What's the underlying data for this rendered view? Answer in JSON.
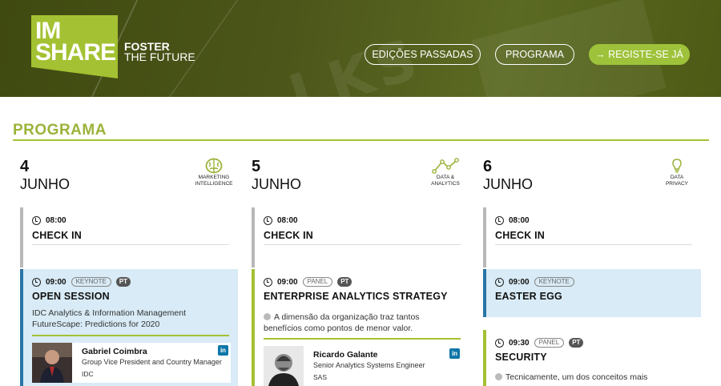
{
  "header": {
    "logo_line1": "IM",
    "logo_line2": "SHARE",
    "tagline1": "FOSTER",
    "tagline2": "THE FUTURE",
    "nav": {
      "past_editions": "EDIÇÕES PASSADAS",
      "program": "PROGRAMA",
      "register": "→ REGISTE-SE JÁ"
    },
    "ghost_text": "LKS"
  },
  "section_title": "PROGRAMA",
  "days": [
    {
      "num": "4",
      "month": "JUNHO",
      "track_line1": "MARKETING",
      "track_line2": "INTELLIGENCE",
      "track_icon": "brain-icon",
      "checkin": {
        "time": "08:00",
        "title": "CHECK IN"
      },
      "session": {
        "time": "09:00",
        "tag": "KEYNOTE",
        "lang": "PT",
        "title": "OPEN SESSION",
        "desc_line1": "IDC Analytics & Information Management",
        "desc_line2": "FutureScape: Predictions for 2020",
        "speaker": {
          "name": "Gabriel Coimbra",
          "role": "Group Vice President and Country Manager",
          "org": "IDC"
        }
      }
    },
    {
      "num": "5",
      "month": "JUNHO",
      "track_line1": "DATA &",
      "track_line2": "ANALYTICS",
      "track_icon": "chart-line-icon",
      "checkin": {
        "time": "08:00",
        "title": "CHECK IN"
      },
      "session": {
        "time": "09:00",
        "tag": "PANEL",
        "lang": "PT",
        "title": "ENTERPRISE ANALYTICS STRATEGY",
        "desc_line1": "A dimensão da organização traz tantos",
        "desc_line2": "benefícios como pontos de menor valor.",
        "speaker": {
          "name": "Ricardo Galante",
          "role": "Senior Analytics Systems Engineer",
          "org": "SAS"
        }
      }
    },
    {
      "num": "6",
      "month": "JUNHO",
      "track_line1": "DATA",
      "track_line2": "PRIVACY",
      "track_icon": "lightbulb-icon",
      "checkin": {
        "time": "08:00",
        "title": "CHECK IN"
      },
      "session": {
        "time": "09:00",
        "tag": "KEYNOTE",
        "title": "EASTER EGG"
      },
      "session2": {
        "time": "09:30",
        "tag": "PANEL",
        "lang": "PT",
        "title": "SECURITY",
        "desc_line1": "Tecnicamente, um dos conceitos mais"
      }
    }
  ],
  "colors": {
    "accent": "#a3c132",
    "blue_border": "#2a74a6",
    "blue_bg": "#d8ebf6",
    "linkedin": "#0e76a8"
  }
}
